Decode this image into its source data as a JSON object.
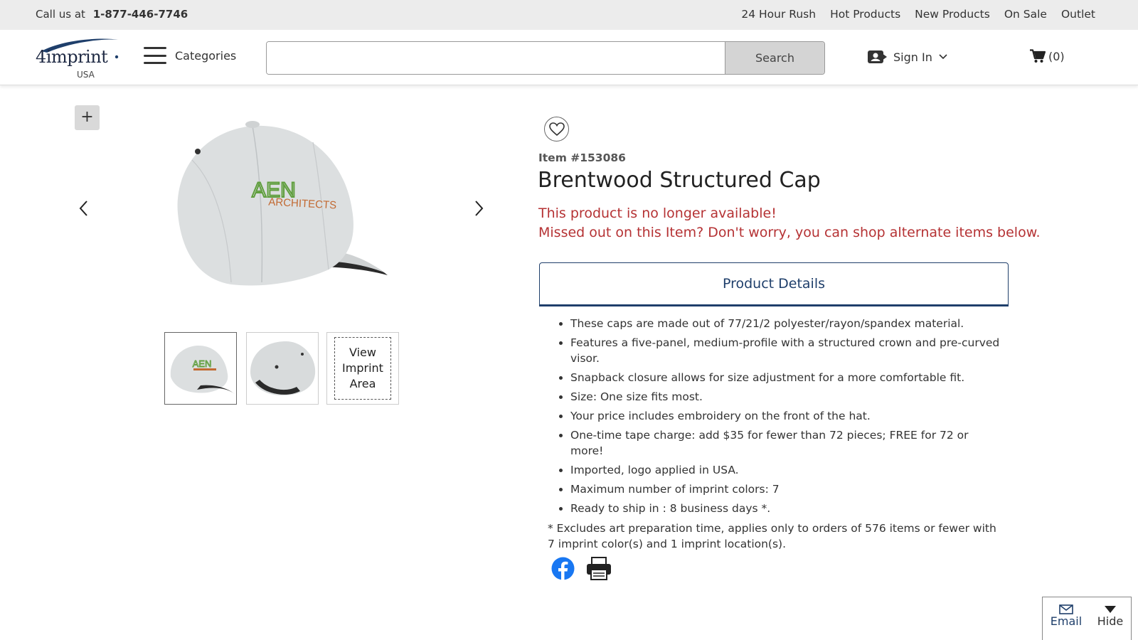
{
  "topbar": {
    "call_label": "Call us at",
    "phone": "1-877-446-7746",
    "links": [
      "24 Hour Rush",
      "Hot Products",
      "New Products",
      "On Sale",
      "Outlet"
    ]
  },
  "header": {
    "logo_text": "4imprint",
    "logo_region": "USA",
    "categories_label": "Categories",
    "search_value": "",
    "search_button": "Search",
    "signin_label": "Sign In",
    "cart_count": "(0)"
  },
  "gallery": {
    "zoom_label": "+",
    "imprint_area_lines": [
      "View",
      "Imprint",
      "Area"
    ],
    "cap_logo_top": "AEN",
    "cap_logo_bottom": "ARCHITECTS"
  },
  "product": {
    "item_number": "Item #153086",
    "title": "Brentwood Structured Cap",
    "unavailable_line1": "This product is no longer available!",
    "unavailable_line2": "Missed out on this Item? Don't worry, you can shop alternate items below.",
    "tab_label": "Product Details",
    "details": [
      "These caps are made out of 77/21/2 polyester/rayon/spandex material.",
      "Features a five-panel, medium-profile with a structured crown and pre-curved visor.",
      "Snapback closure allows for size adjustment for a more comfortable fit.",
      "Size: One size fits most.",
      "Your price includes embroidery on the front of the hat.",
      "One-time tape charge: add $35 for fewer than 72 pieces; FREE for 72 or more!",
      "Imported, logo applied in USA.",
      "Maximum number of imprint colors: 7",
      "Ready to ship in : 8 business days *."
    ],
    "footnote": "* Excludes art preparation time, applies only to orders of 576 items or fewer with 7 imprint color(s) and 1 imprint location(s)."
  },
  "widget": {
    "email_label": "Email",
    "hide_label": "Hide"
  },
  "colors": {
    "accent_blue": "#1f3f6b",
    "alert_red": "#b53234",
    "facebook_blue": "#1877f2",
    "topbar_bg": "#ececec"
  },
  "icons": [
    "hamburger-icon",
    "account-icon",
    "chevron-down-icon",
    "cart-icon",
    "heart-icon",
    "chevron-left-icon",
    "chevron-right-icon",
    "facebook-icon",
    "print-icon",
    "email-icon",
    "triangle-down-icon"
  ]
}
